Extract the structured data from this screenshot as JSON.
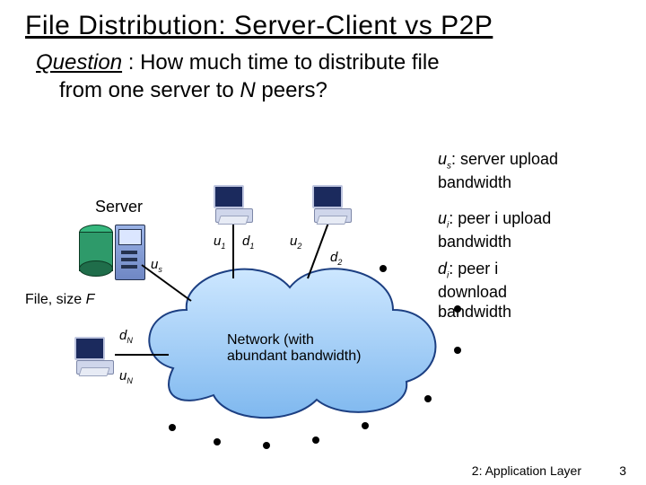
{
  "title": "File Distribution: Server-Client vs P2P",
  "question": {
    "label": "Question",
    "sep": " : ",
    "line1": "How much time to distribute file",
    "line2_a": "from one server to ",
    "N": "N",
    "line2_b": "  peers?"
  },
  "labels": {
    "server": "Server",
    "file_a": "File, size ",
    "file_F": "F",
    "cloud_a": "Network (with",
    "cloud_b": "abundant bandwidth)"
  },
  "rates": {
    "us": "u",
    "us_sub": "s",
    "u1": "u",
    "u1_sub": "1",
    "d1": "d",
    "d1_sub": "1",
    "u2": "u",
    "u2_sub": "2",
    "d2": "d",
    "d2_sub": "2",
    "dN": "d",
    "dN_sub": "N",
    "uN": "u",
    "uN_sub": "N"
  },
  "legend": {
    "us_a": "u",
    "us_sub": "s",
    "us_b": ": server upload",
    "us_c": "bandwidth",
    "ui_a": "u",
    "ui_sub": "i",
    "ui_b": ": peer i upload",
    "ui_c": "bandwidth",
    "di_a": "d",
    "di_sub": "i",
    "di_b": ": peer i download",
    "di_c": "bandwidth"
  },
  "footer": "2: Application Layer",
  "page": "3",
  "chart_data": {
    "type": "diagram",
    "title": "File Distribution: Server-Client vs P2P",
    "nodes": [
      {
        "id": "server",
        "label": "Server",
        "attrs": {
          "upload": "u_s",
          "file_size": "F"
        }
      },
      {
        "id": "network",
        "label": "Network (with abundant bandwidth)"
      },
      {
        "id": "peer1",
        "label": "Peer 1",
        "attrs": {
          "upload": "u_1",
          "download": "d_1"
        }
      },
      {
        "id": "peer2",
        "label": "Peer 2",
        "attrs": {
          "upload": "u_2",
          "download": "d_2"
        }
      },
      {
        "id": "peerN",
        "label": "Peer N",
        "attrs": {
          "upload": "u_N",
          "download": "d_N"
        }
      }
    ],
    "edges": [
      {
        "from": "server",
        "to": "network",
        "label": "u_s"
      },
      {
        "from": "peer1",
        "to": "network",
        "label": "u_1 / d_1"
      },
      {
        "from": "peer2",
        "to": "network",
        "label": "u_2 / d_2"
      },
      {
        "from": "peerN",
        "to": "network",
        "label": "u_N / d_N"
      }
    ],
    "legend": [
      "u_s: server upload bandwidth",
      "u_i: peer i upload bandwidth",
      "d_i: peer i download bandwidth"
    ],
    "peers_shown": 3,
    "peers_implied": "N"
  }
}
